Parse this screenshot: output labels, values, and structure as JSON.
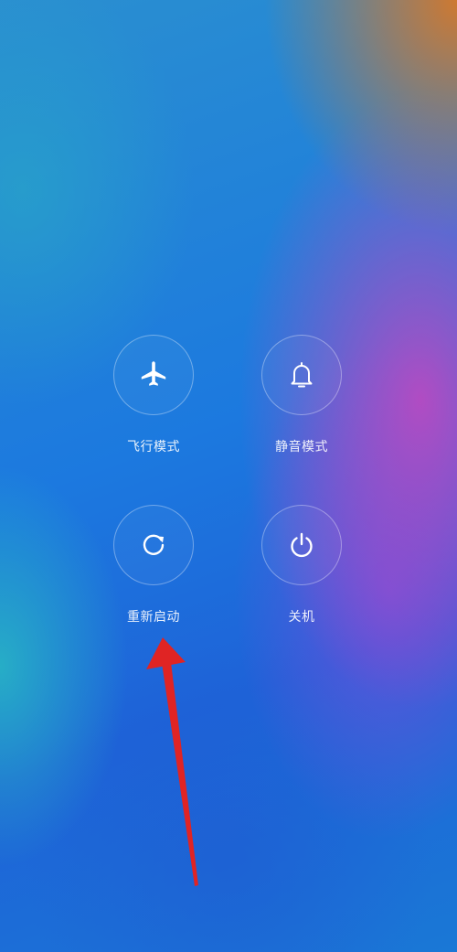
{
  "power_menu": {
    "airplane": {
      "label": "飞行模式",
      "icon": "airplane-icon"
    },
    "silent": {
      "label": "静音模式",
      "icon": "bell-icon"
    },
    "restart": {
      "label": "重新启动",
      "icon": "restart-icon"
    },
    "power": {
      "label": "关机",
      "icon": "power-icon"
    }
  },
  "annotation": {
    "arrow_color": "#e02424",
    "target": "restart"
  },
  "colors": {
    "icon": "#ffffff",
    "ring": "rgba(255,255,255,0.35)"
  }
}
